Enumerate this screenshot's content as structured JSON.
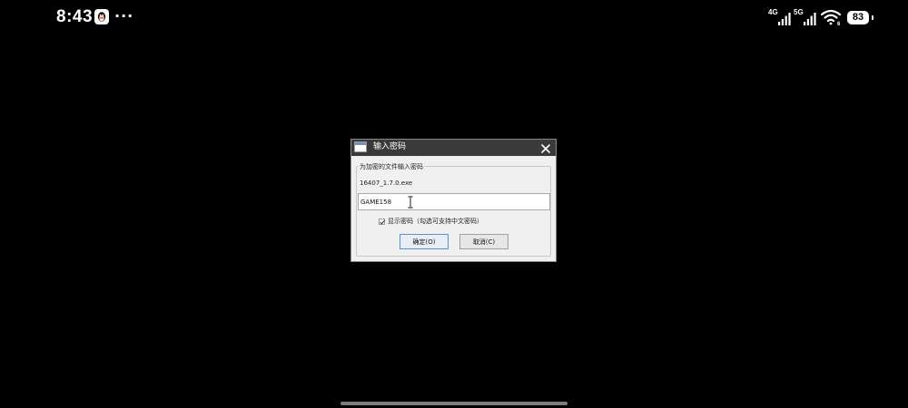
{
  "status_bar": {
    "time": "8:43",
    "more": "···",
    "network_1": "4G",
    "network_2": "5G",
    "battery": "83"
  },
  "dialog": {
    "title": "输入密码",
    "group_label": "为加密的文件输入密码",
    "file_name": "16407_1.7.0.exe",
    "password_value": "GAME158",
    "show_password_checked": true,
    "show_password_label": "显示密码（勾选可支持中文密码）",
    "ok_label": "确定(O)",
    "cancel_label": "取消(C)"
  },
  "colors": {
    "background": "#000000",
    "titlebar": "#3a3a3a",
    "dialog_body": "#f0f0f0",
    "focus_border": "#5b8fd6"
  },
  "icons": [
    "qq-icon",
    "more-icon",
    "signal-icon",
    "wifi-icon",
    "battery-icon",
    "app-window-icon",
    "close-icon",
    "text-cursor-icon",
    "checkmark-icon"
  ]
}
